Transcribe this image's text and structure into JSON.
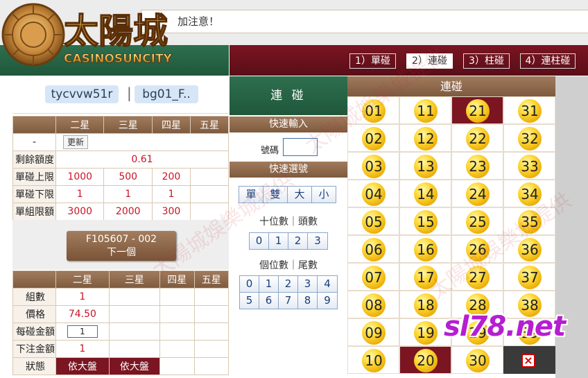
{
  "header": {
    "marquee_text": "加注意！",
    "logo": {
      "main": "太陽城",
      "sub": "CASINOSUNCITY"
    }
  },
  "modes": [
    {
      "label": "1）單碰",
      "active": false
    },
    {
      "label": "2）連碰",
      "active": true
    },
    {
      "label": "3）柱碰",
      "active": false
    },
    {
      "label": "4）連柱碰",
      "active": false
    }
  ],
  "user": {
    "account": "tycvvw51r",
    "separator": "|",
    "group": "bg01_F.."
  },
  "limits": {
    "headers": [
      "二星",
      "三星",
      "四星",
      "五星"
    ],
    "dash": "-",
    "refresh_label": "更新",
    "remaining_label": "剩餘額度",
    "remaining_value": "0.61",
    "rows": [
      {
        "label": "單碰上限",
        "values": [
          "1000",
          "500",
          "200",
          ""
        ]
      },
      {
        "label": "單碰下限",
        "values": [
          "1",
          "1",
          "1",
          ""
        ]
      },
      {
        "label": "單組限額",
        "values": [
          "3000",
          "2000",
          "300",
          ""
        ]
      }
    ]
  },
  "draw": {
    "code": "F105607 - 002",
    "next_label": "下一個"
  },
  "bet": {
    "headers": [
      "二星",
      "三星",
      "四星",
      "五星"
    ],
    "groups_label": "組數",
    "groups_value": "1",
    "price_label": "價格",
    "price_value": "74.50",
    "amount_label": "每碰金額",
    "amount_value": "1",
    "total_label": "下注金額",
    "total_value": "1",
    "status_label": "狀態",
    "status_values": [
      "依大盤",
      "依大盤"
    ]
  },
  "middle": {
    "title": "連 碰",
    "quick_input": "快速輸入",
    "number_label": "號碼",
    "quick_select": "快速選號",
    "parity_buttons": [
      "單",
      "雙",
      "大",
      "小"
    ],
    "tens_label": "十位數｜頭數",
    "tens_buttons": [
      "0",
      "1",
      "2",
      "3"
    ],
    "units_label": "個位數｜尾數",
    "units_row1": [
      "0",
      "1",
      "2",
      "3",
      "4"
    ],
    "units_row2": [
      "5",
      "6",
      "7",
      "8",
      "9"
    ]
  },
  "grid": {
    "title": "連碰",
    "columns": [
      [
        "01",
        "02",
        "03",
        "04",
        "05",
        "06",
        "07",
        "08",
        "09",
        "10"
      ],
      [
        "11",
        "12",
        "13",
        "14",
        "15",
        "16",
        "17",
        "18",
        "19",
        "20"
      ],
      [
        "21",
        "22",
        "23",
        "24",
        "25",
        "26",
        "27",
        "28",
        "29",
        "30"
      ],
      [
        "31",
        "32",
        "33",
        "34",
        "35",
        "36",
        "37",
        "38",
        "39",
        ""
      ]
    ],
    "selected": [
      "21",
      "20"
    ]
  },
  "watermark": "sl78.net",
  "colors": {
    "green": "#2e6f4e",
    "maroon": "#7a1521",
    "brown": "#8a6446",
    "ball": "#ffd93a"
  }
}
